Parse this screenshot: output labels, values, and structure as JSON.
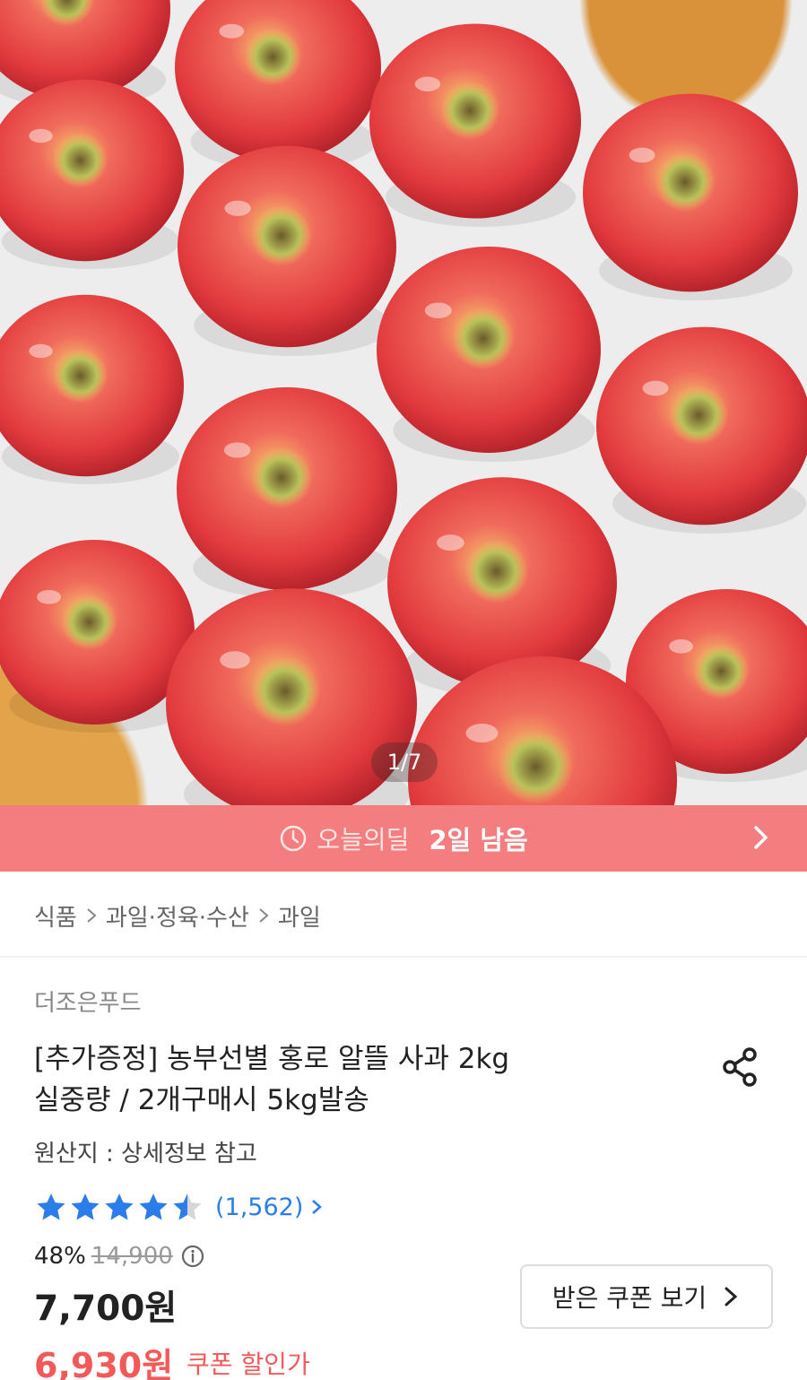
{
  "image": {
    "counter": "1/7"
  },
  "deal": {
    "label": "오늘의딜",
    "remaining": "2일 남음"
  },
  "breadcrumb": [
    "식품",
    "과일·정육·수산",
    "과일"
  ],
  "product": {
    "brand": "더조은푸드",
    "title_line1": "[추가증정] 농부선별 홍로 알뜰 사과 2kg",
    "title_line2": "실중량 / 2개구매시 5kg발송",
    "origin": "원산지 : 상세정보 참고",
    "rating_value": 4.5,
    "review_count": "(1,562)",
    "discount": "48%",
    "original_price": "14,900",
    "price": "7,700원",
    "coupon_price": "6,930원",
    "coupon_price_label": "쿠폰 할인가",
    "coupon_button": "받은 쿠폰 보기"
  },
  "colors": {
    "deal_banner": "#f47d7f",
    "star": "#2b7de9",
    "coupon_price": "#f25a5a"
  }
}
